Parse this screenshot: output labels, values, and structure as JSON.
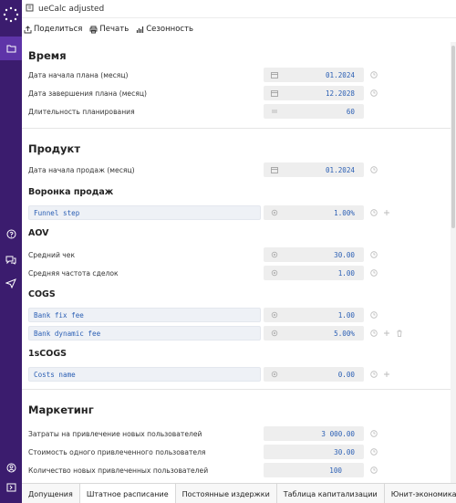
{
  "app": {
    "title": "ueCalc adjusted"
  },
  "toolbar": {
    "share": "Поделиться",
    "print": "Печать",
    "seasonality": "Сезонность"
  },
  "sections": {
    "time": {
      "title": "Время",
      "rows": [
        {
          "label": "Дата начала плана (месяц)",
          "value": "01.2024",
          "icon": "calendar-icon"
        },
        {
          "label": "Дата завершения плана (месяц)",
          "value": "12.2028",
          "icon": "calendar-icon"
        },
        {
          "label": "Длительность планирования",
          "value": "60",
          "icon": "equals-icon"
        }
      ]
    },
    "product": {
      "title": "Продукт",
      "sales_start": {
        "label": "Дата начала продаж (месяц)",
        "value": "01.2024"
      },
      "funnel": {
        "title": "Воронка продаж",
        "items": [
          {
            "label": "Funnel step",
            "value": "1.00%"
          }
        ]
      },
      "aov": {
        "title": "AOV",
        "rows": [
          {
            "label": "Средний чек",
            "value": "30.00"
          },
          {
            "label": "Средняя частота сделок",
            "value": "1.00"
          }
        ]
      },
      "cogs": {
        "title": "COGS",
        "items": [
          {
            "label": "Bank fix fee",
            "value": "1.00"
          },
          {
            "label": "Bank dynamic fee",
            "value": "5.00%"
          }
        ]
      },
      "one_s_cogs": {
        "title": "1sCOGS",
        "items": [
          {
            "label": "Costs name",
            "value": "0.00"
          }
        ]
      }
    },
    "marketing": {
      "title": "Маркетинг",
      "rows": [
        {
          "label": "Затраты на привлечение новых пользователей",
          "value": "3 000.00"
        },
        {
          "label": "Стоимость одного привлеченного пользователя",
          "value": "30.00"
        },
        {
          "label": "Количество новых привлеченных пользователей",
          "value": "100"
        }
      ]
    }
  },
  "tabs": [
    "Допущения",
    "Штатное расписание",
    "Постоянные издержки",
    "Таблица капитализации",
    "Юнит-экономика"
  ],
  "colors": {
    "sidebar": "#3b1c6e",
    "sidebar_active": "#5e34a8",
    "value_text": "#2b5fb4"
  }
}
